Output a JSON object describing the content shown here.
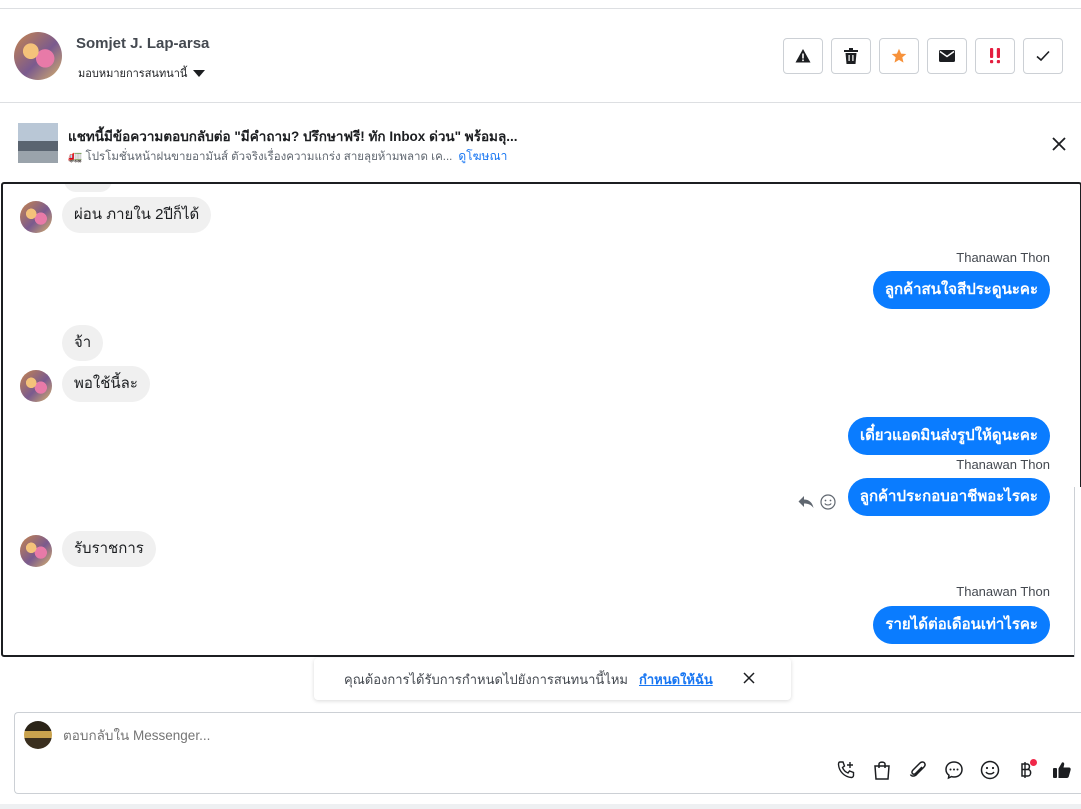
{
  "header": {
    "contact_name": "Somjet J. Lap-arsa",
    "assign_label": "มอบหมายการสนทนานี้",
    "actions": [
      {
        "name": "spam-button",
        "icon": "warning-icon"
      },
      {
        "name": "delete-button",
        "icon": "trash-icon"
      },
      {
        "name": "star-button",
        "icon": "star-icon"
      },
      {
        "name": "mark-unread-button",
        "icon": "envelope-icon"
      },
      {
        "name": "priority-button",
        "icon": "double-exclamation-icon"
      },
      {
        "name": "mark-done-button",
        "icon": "check-icon"
      }
    ]
  },
  "ad": {
    "title": "แชทนี้มีข้อความตอบกลับต่อ \"มีคำถาม? ปรึกษาฟรี! ทัก Inbox ด่วน\" พร้อมลุ...",
    "subtitle": "🚛 โปรโมชั่นหน้าฝนขายอามันส์ ตัวจริงเรื่องความแกร่ง สายลุยห้ามพลาด เค...",
    "link": "ดูโฆษณา"
  },
  "messages": [
    {
      "dir": "in",
      "text": "ผ่อน ภายใน 2ปีก็ได้"
    },
    {
      "dir": "out",
      "sender": "Thanawan Thon",
      "text": "ลูกค้าสนใจสีประดูนะคะ"
    },
    {
      "dir": "in",
      "text": "จ้า"
    },
    {
      "dir": "in",
      "text": "พอใช้นี้ละ"
    },
    {
      "dir": "out",
      "text": "เดี๋ยวแอดมินส่งรูปให้ดูนะคะ"
    },
    {
      "dir": "out",
      "sender": "Thanawan Thon",
      "text": "ลูกค้าประกอบอาชีพอะไรคะ"
    },
    {
      "dir": "in",
      "text": "รับราชการ"
    },
    {
      "dir": "out",
      "sender": "Thanawan Thon",
      "text": "รายได้ต่อเดือนเท่าไรคะ"
    }
  ],
  "toast": {
    "text": "คุณต้องการได้รับการกำหนดไปยังการสนทนานี้ไหม",
    "link": "กำหนดให้ฉัน"
  },
  "composer": {
    "placeholder": "ตอบกลับใน Messenger...",
    "tools": [
      "phone-add-icon",
      "shopping-bag-icon",
      "paperclip-icon",
      "chat-bubble-icon",
      "emoji-icon",
      "baht-icon",
      "thumbs-up-icon"
    ]
  },
  "colors": {
    "outgoing_bubble": "#0a7cff",
    "incoming_bubble": "#f0f0f0",
    "link": "#1876f2",
    "star": "#f7923b",
    "priority": "#e41e3f"
  }
}
